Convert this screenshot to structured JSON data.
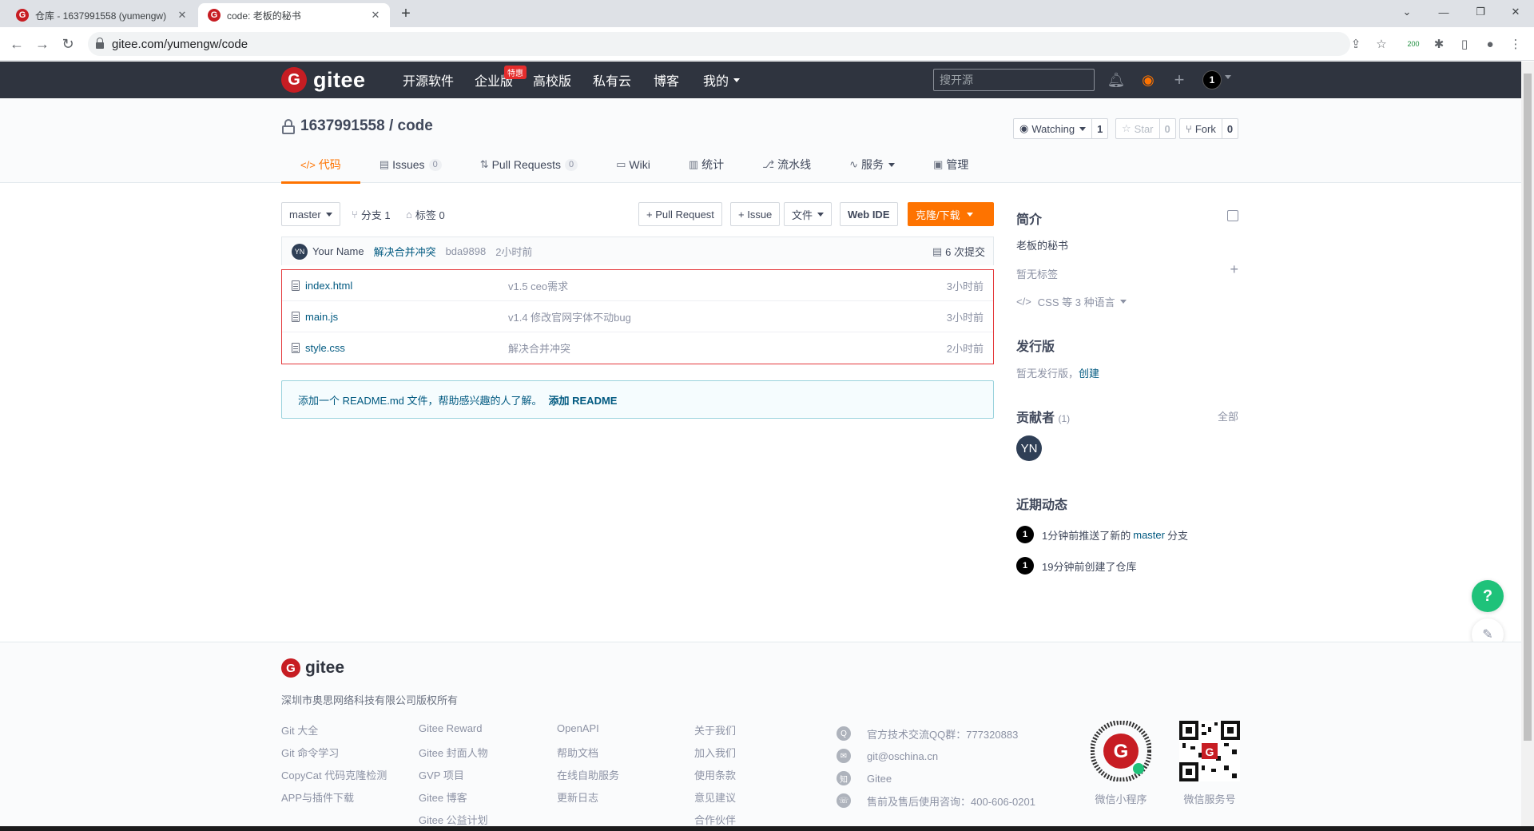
{
  "browser": {
    "tabs": [
      {
        "title": "仓库 - 1637991558 (yumengw)",
        "active": false
      },
      {
        "title": "code: 老板的秘书",
        "active": true
      }
    ],
    "url": "gitee.com/yumengw/code",
    "ext_badge": "200"
  },
  "header": {
    "logo": "gitee",
    "nav": [
      "开源软件",
      "企业版",
      "高校版",
      "私有云",
      "博客",
      "我的"
    ],
    "hot_badge": "特惠",
    "search_placeholder": "搜开源",
    "avatar": "1"
  },
  "project": {
    "owner_repo": "1637991558 / code",
    "watch": {
      "label": "Watching",
      "count": "1"
    },
    "star": {
      "label": "Star",
      "count": "0"
    },
    "fork": {
      "label": "Fork",
      "count": "0"
    },
    "tabs": [
      {
        "label": "代码",
        "icon": "</>",
        "active": true
      },
      {
        "label": "Issues",
        "badge": "0"
      },
      {
        "label": "Pull Requests",
        "badge": "0"
      },
      {
        "label": "Wiki"
      },
      {
        "label": "统计"
      },
      {
        "label": "流水线"
      },
      {
        "label": "服务"
      },
      {
        "label": "管理"
      }
    ]
  },
  "toolbar": {
    "branch": "master",
    "branches": "分支 1",
    "tags": "标签 0",
    "pull_request": "+ Pull Request",
    "issue": "+ Issue",
    "file": "文件",
    "web_ide": "Web IDE",
    "clone": "克隆/下载"
  },
  "commit": {
    "avatar": "YN",
    "author": "Your Name",
    "message": "解决合并冲突",
    "sha": "bda9898",
    "time": "2小时前",
    "count": "6 次提交"
  },
  "files": [
    {
      "name": "index.html",
      "message": "v1.5 ceo需求",
      "time": "3小时前"
    },
    {
      "name": "main.js",
      "message": "v1.4 修改官网字体不动bug",
      "time": "3小时前"
    },
    {
      "name": "style.css",
      "message": "解决合并冲突",
      "time": "2小时前"
    }
  ],
  "readme_notice": {
    "text": "添加一个 README.md 文件，帮助感兴趣的人了解。",
    "link": "添加 README"
  },
  "sidebar": {
    "intro_title": "简介",
    "intro_text": "老板的秘书",
    "no_tags": "暂无标签",
    "languages": "CSS 等 3 种语言",
    "release_title": "发行版",
    "no_release": "暂无发行版，",
    "create": "创建",
    "contributors_title": "贡献者",
    "contributors_count": "(1)",
    "all": "全部",
    "contributor_avatar": "YN",
    "activity_title": "近期动态",
    "activity": [
      {
        "avatar": "1",
        "pre": "1分钟前推送了新的 ",
        "link": "master",
        "post": " 分支"
      },
      {
        "avatar": "1",
        "pre": "19分钟前创建了仓库",
        "link": "",
        "post": ""
      }
    ]
  },
  "fab": {
    "help": "?"
  },
  "footer": {
    "logo": "gitee",
    "copyright": "深圳市奥思网络科技有限公司版权所有",
    "col1": [
      "Git 大全",
      "Git 命令学习",
      "CopyCat 代码克隆检测",
      "APP与插件下载"
    ],
    "col2": [
      "Gitee Reward",
      "Gitee 封面人物",
      "GVP 项目",
      "Gitee 博客",
      "Gitee 公益计划"
    ],
    "col3": [
      "OpenAPI",
      "帮助文档",
      "在线自助服务",
      "更新日志"
    ],
    "col4": [
      "关于我们",
      "加入我们",
      "使用条款",
      "意见建议",
      "合作伙伴"
    ],
    "contact": [
      {
        "icon": "qq-icon",
        "text": "官方技术交流QQ群：777320883"
      },
      {
        "icon": "mail-icon",
        "text": "git@oschina.cn"
      },
      {
        "icon": "zhihu-icon",
        "text": "Gitee"
      },
      {
        "icon": "phone-icon",
        "text": "售前及售后使用咨询：400-606-0201"
      }
    ],
    "qr1_label": "微信小程序",
    "qr2_label": "微信服务号"
  },
  "colors": {
    "brand": "#c71d23",
    "accent": "#fe7300",
    "header": "#2f343f",
    "link": "#005980"
  }
}
